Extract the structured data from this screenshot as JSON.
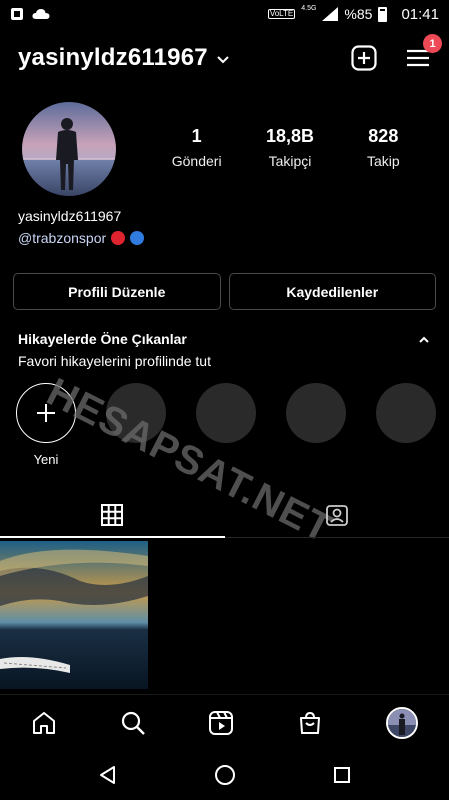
{
  "status_bar": {
    "volte": "VoLTE",
    "network": "4.5G",
    "battery": "%85",
    "time": "01:41"
  },
  "header": {
    "username": "yasinyldz611967",
    "notification_count": "1"
  },
  "profile": {
    "stats": [
      {
        "value": "1",
        "label": "Gönderi"
      },
      {
        "value": "18,8B",
        "label": "Takipçi"
      },
      {
        "value": "828",
        "label": "Takip"
      }
    ],
    "name": "yasinyldz611967",
    "bio_handle": "@trabzonspor"
  },
  "buttons": {
    "edit_profile": "Profili Düzenle",
    "saved": "Kaydedilenler"
  },
  "highlights": {
    "title": "Hikayelerde Öne Çıkanlar",
    "subtitle": "Favori hikayelerini profilinde tut",
    "new_label": "Yeni"
  },
  "watermark": "HESAPSAT.NET",
  "colors": {
    "badge": "#ed4956",
    "dot_red": "#e0242f",
    "dot_blue": "#2f7be0",
    "placeholder": "#2a2a2a"
  }
}
